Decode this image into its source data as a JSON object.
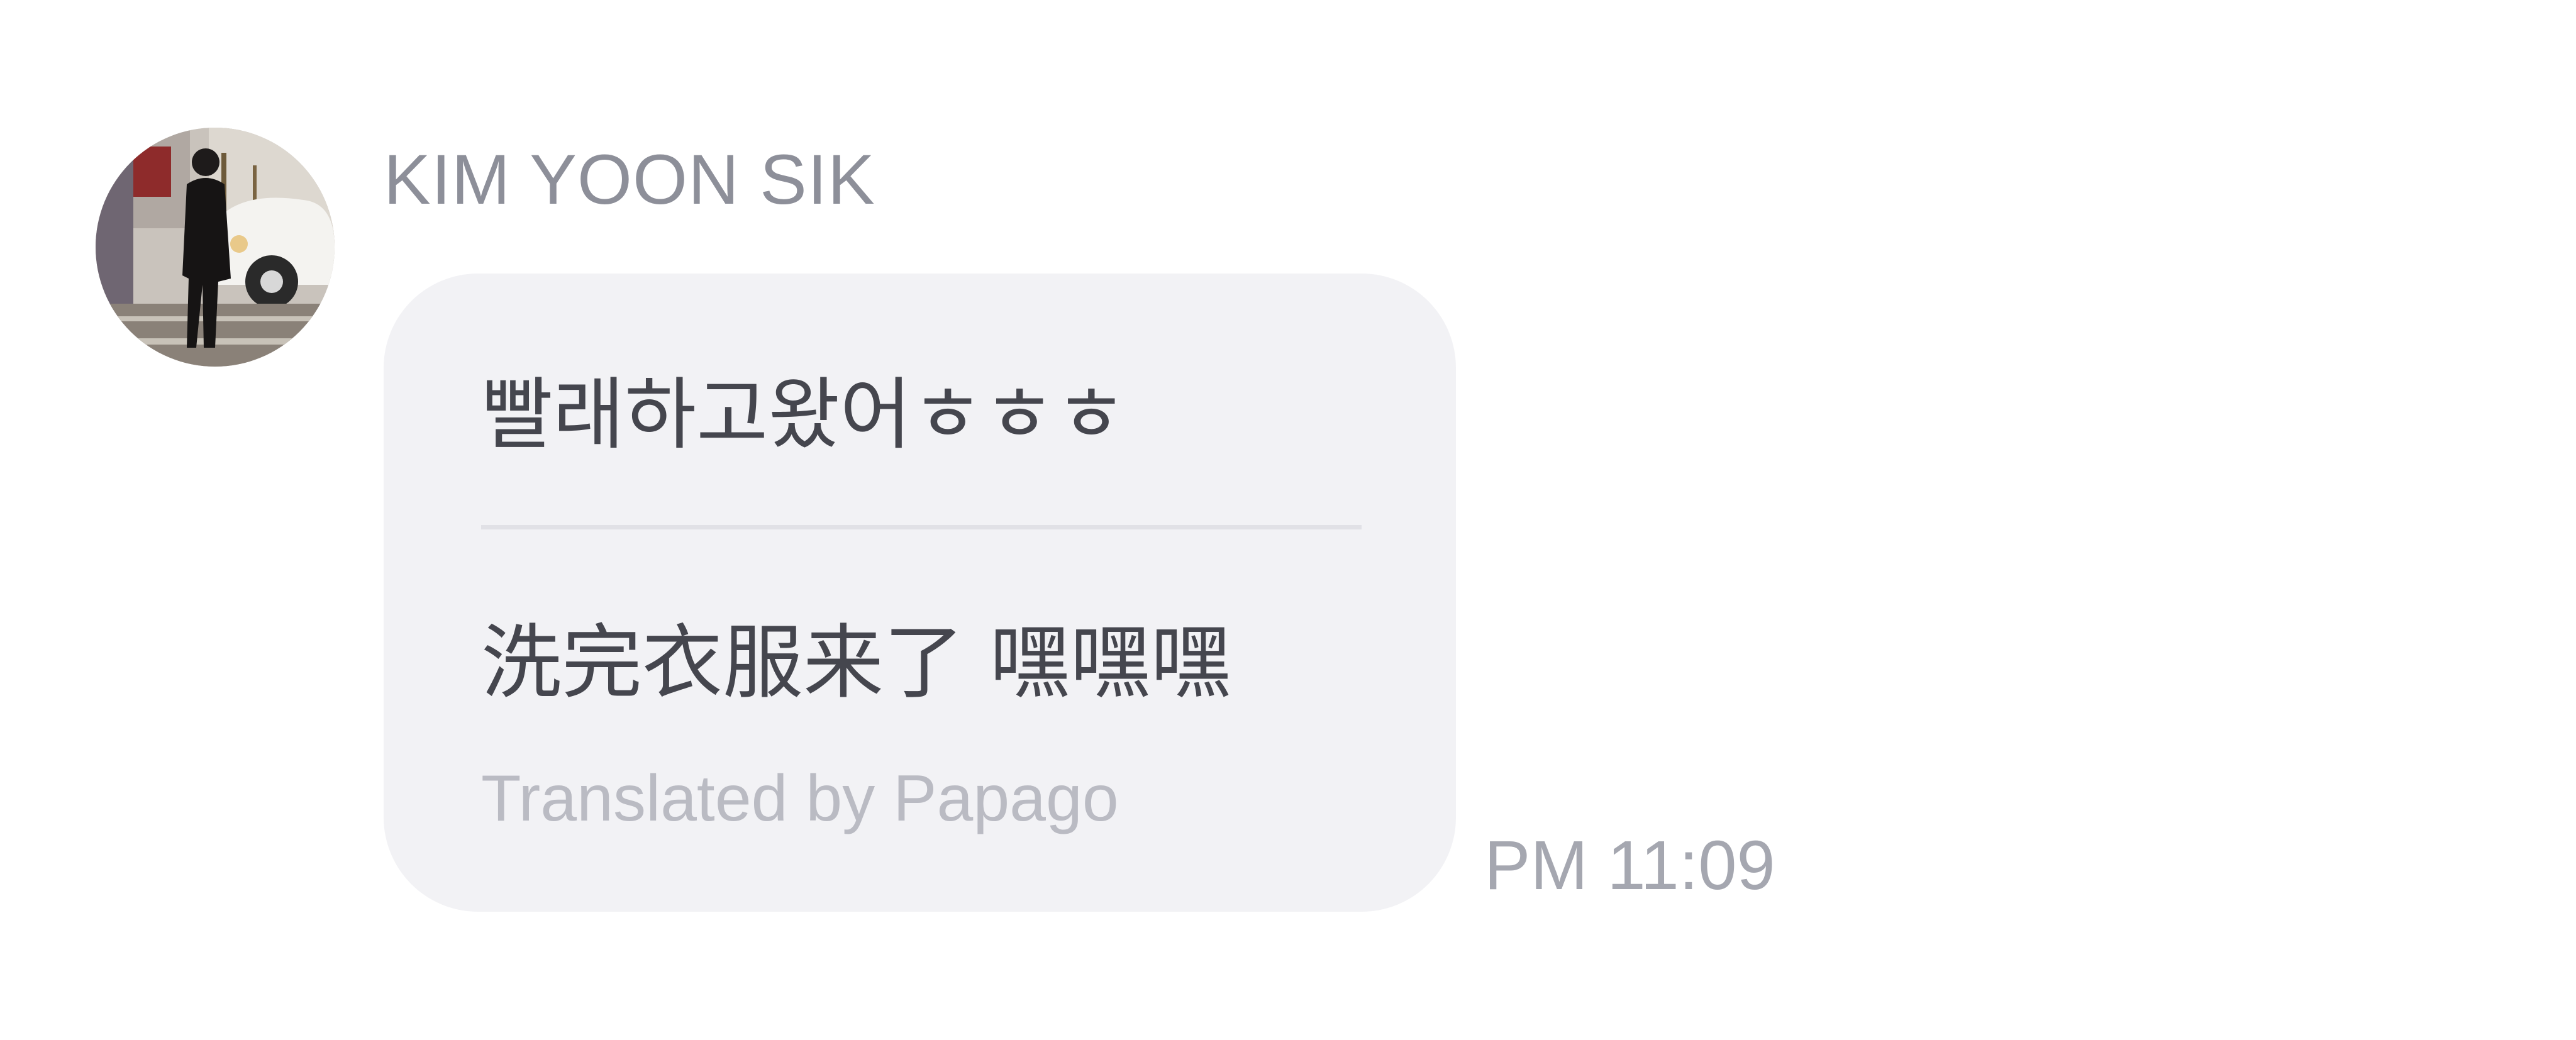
{
  "message": {
    "sender": {
      "name": "KIM YOON SIK",
      "avatar": "avatar-photo"
    },
    "original_text": "빨래하고왔어ㅎㅎㅎ",
    "translated_text": "洗完衣服来了 嘿嘿嘿",
    "translator_label": "Translated by Papago",
    "timestamp": "PM 11:09"
  },
  "colors": {
    "background": "#ffffff",
    "bubble": "#f2f2f5",
    "sender_name": "#8d8f99",
    "message_text": "#45464e",
    "translator_label": "#babbc3",
    "timestamp": "#a5a7b0"
  }
}
